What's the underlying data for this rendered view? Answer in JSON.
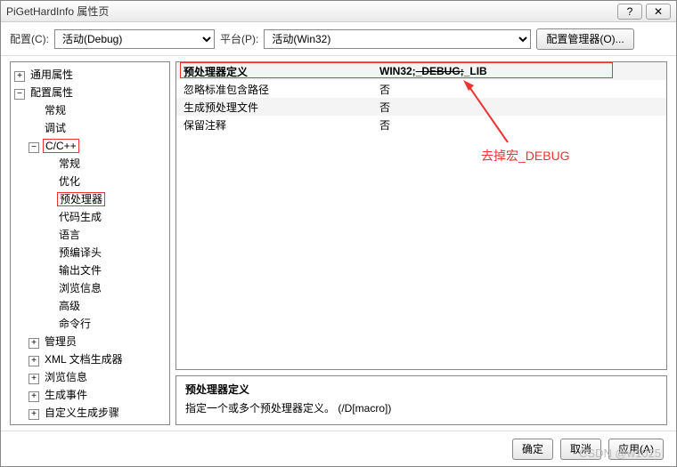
{
  "window": {
    "title": "PiGetHardInfo 属性页"
  },
  "toolbar": {
    "config_label": "配置(C):",
    "config_value": "活动(Debug)",
    "platform_label": "平台(P):",
    "platform_value": "活动(Win32)",
    "config_manager_btn": "配置管理器(O)..."
  },
  "tree": {
    "general": "通用属性",
    "config_props": "配置属性",
    "items": {
      "general": "常规",
      "debugging": "调试",
      "cpp": "C/C++",
      "cpp_general": "常规",
      "cpp_optimize": "优化",
      "cpp_preprocessor": "预处理器",
      "cpp_codegen": "代码生成",
      "cpp_language": "语言",
      "cpp_pch": "预编译头",
      "cpp_output": "输出文件",
      "cpp_browse": "浏览信息",
      "cpp_advanced": "高级",
      "cpp_cmdline": "命令行",
      "admin": "管理员",
      "xmldoc": "XML 文档生成器",
      "browse": "浏览信息",
      "build_events": "生成事件",
      "custom_build": "自定义生成步骤"
    }
  },
  "grid": {
    "rows": [
      {
        "name": "预处理器定义",
        "value_prefix": "WIN32;",
        "value_strike": "_DEBUG;",
        "value_suffix": "_LIB"
      },
      {
        "name": "忽略标准包含路径",
        "value": "否"
      },
      {
        "name": "生成预处理文件",
        "value": "否"
      },
      {
        "name": "保留注释",
        "value": "否"
      }
    ]
  },
  "desc": {
    "title": "预处理器定义",
    "body": "指定一个或多个预处理器定义。     (/D[macro])"
  },
  "buttons": {
    "ok": "确定",
    "cancel": "取消",
    "apply": "应用(A)"
  },
  "annotation": "去掉宏_DEBUG",
  "watermark": "CSDN @w1025"
}
